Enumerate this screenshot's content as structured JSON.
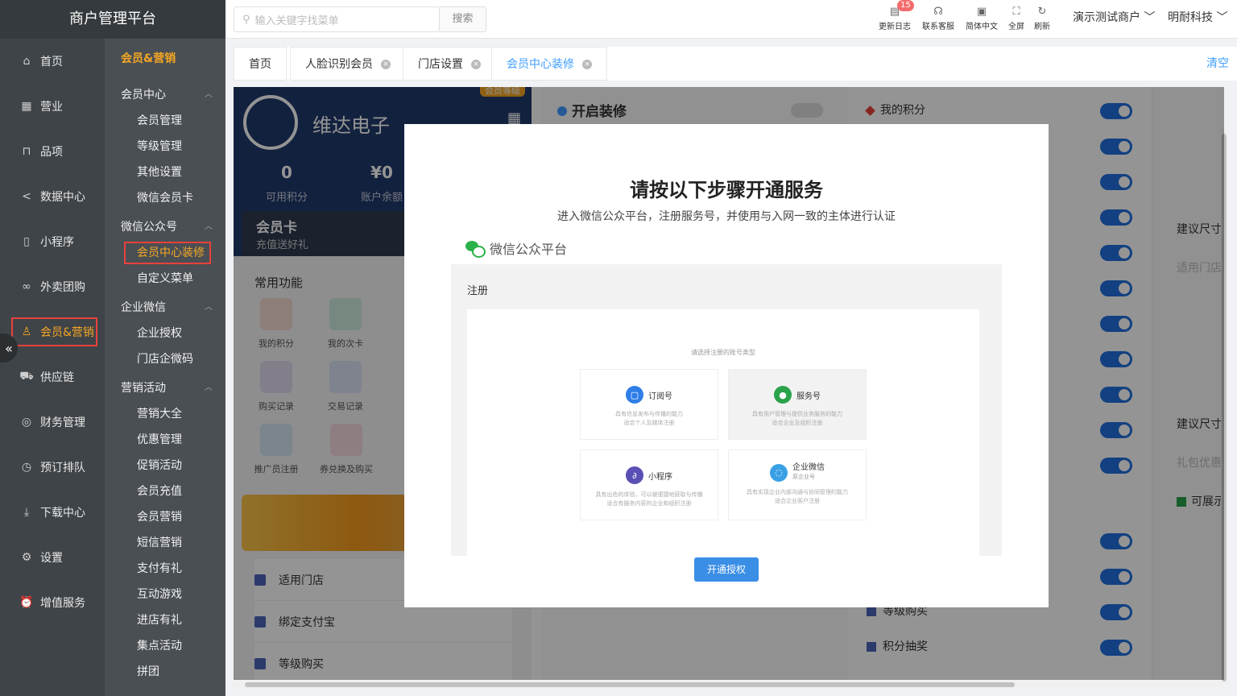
{
  "app": {
    "title": "商户管理平台"
  },
  "sidebar": {
    "items": [
      {
        "label": "首页",
        "icon": "home-icon"
      },
      {
        "label": "营业",
        "icon": "calendar-icon"
      },
      {
        "label": "品项",
        "icon": "bag-icon"
      },
      {
        "label": "数据中心",
        "icon": "share-icon"
      },
      {
        "label": "小程序",
        "icon": "phone-icon"
      },
      {
        "label": "外卖团购",
        "icon": "bike-icon"
      },
      {
        "label": "会员&营销",
        "icon": "user-icon",
        "active": true
      },
      {
        "label": "供应链",
        "icon": "truck-icon"
      },
      {
        "label": "财务管理",
        "icon": "coins-icon"
      },
      {
        "label": "预订排队",
        "icon": "clock-icon"
      },
      {
        "label": "下载中心",
        "icon": "download-icon"
      },
      {
        "label": "设置",
        "icon": "gear-icon"
      },
      {
        "label": "增值服务",
        "icon": "alarm-icon"
      }
    ],
    "collapse_glyph": "«"
  },
  "submenu": {
    "title": "会员&营销",
    "groups": [
      {
        "label": "会员中心",
        "items": [
          "会员管理",
          "等级管理",
          "其他设置",
          "微信会员卡"
        ]
      },
      {
        "label": "微信公众号",
        "items": [
          "会员中心装修",
          "自定义菜单"
        ]
      },
      {
        "label": "企业微信",
        "items": [
          "企业授权",
          "门店企微码"
        ]
      },
      {
        "label": "营销活动",
        "items": [
          "营销大全",
          "优惠管理",
          "促销活动",
          "会员充值",
          "会员营销",
          "短信营销",
          "支付有礼",
          "互动游戏",
          "进店有礼",
          "集点活动",
          "拼团"
        ]
      }
    ],
    "active_item": "会员中心装修"
  },
  "header": {
    "search_placeholder": "输入关键字找菜单",
    "search_button": "搜索",
    "tools": [
      {
        "label": "更新日志",
        "icon": "log-icon",
        "badge": "15"
      },
      {
        "label": "联系客服",
        "icon": "headset-icon"
      },
      {
        "label": "简体中文",
        "icon": "language-icon"
      },
      {
        "label": "全屏",
        "icon": "fullscreen-icon"
      },
      {
        "label": "刷新",
        "icon": "refresh-icon"
      }
    ],
    "merchant": "演示测试商户",
    "company": "明耐科技"
  },
  "tabs": {
    "items": [
      "首页",
      "人脸识别会员",
      "门店设置",
      "会员中心装修"
    ],
    "current": "会员中心装修",
    "clear_label": "清空"
  },
  "preview": {
    "shop_name": "维达电子",
    "points_value": "0",
    "points_label": "可用积分",
    "balance_value": "¥0",
    "balance_label": "账户余额",
    "card_title": "会员卡",
    "card_sub": "充值送好礼",
    "top_tag": "会员等级",
    "common_title": "常用功能",
    "functions": [
      "我的积分",
      "我的次卡",
      "购买记录",
      "交易记录",
      "推广员注册",
      "券兑换及购买"
    ],
    "list": [
      "适用门店",
      "绑定支付宝",
      "等级购买"
    ]
  },
  "settings": {
    "open_decor_label": "开启装修",
    "rows": [
      "我的积分",
      "等级购买",
      "积分抽奖"
    ]
  },
  "far": {
    "suggest1": "建议尺寸",
    "apply_store": "适用门店",
    "suggest2": "建议尺寸",
    "gift": "礼包优惠",
    "expandable": "可展示"
  },
  "modal": {
    "title": "请按以下步骤开通服务",
    "subtitle": "进入微信公众平台，注册服务号，并使用与入网一致的主体进行认证",
    "platform_label": "微信公众平台",
    "register_label": "注册",
    "select_hint": "请选择注册的账号类型",
    "accounts": [
      {
        "name": "订阅号",
        "desc1": "具有信息发布与传播的能力",
        "desc2": "适合个人及媒体注册",
        "color": "#2f7ee8",
        "glyph": "▢"
      },
      {
        "name": "服务号",
        "desc1": "具有用户管理与提供业务服务的能力",
        "desc2": "适合企业及组织注册",
        "color": "#2aa24b",
        "glyph": "●"
      },
      {
        "name": "小程序",
        "desc1": "具有出色的体验，可以被便捷地获取与传播",
        "desc2": "适合有服务内容的企业和组织注册",
        "color": "#5a4fb5",
        "glyph": "∂"
      },
      {
        "name": "企业微信",
        "sub": "原企业号",
        "desc1": "具有实现企业内部沟通与协同管理的能力",
        "desc2": "适合企业客户注册",
        "color": "#39a0e6",
        "glyph": "◌"
      }
    ],
    "auth_button": "开通授权"
  }
}
